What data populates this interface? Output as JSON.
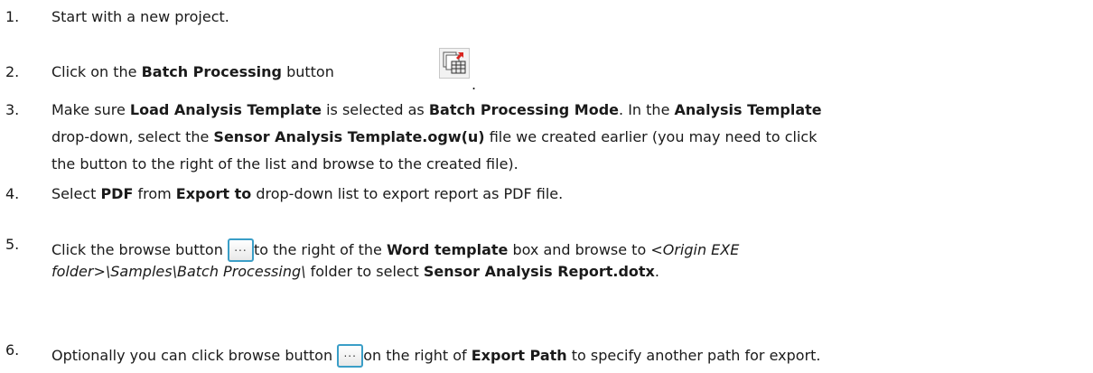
{
  "steps": [
    {
      "num": "1.",
      "text": "Start with a new project."
    },
    {
      "num": "2.",
      "pre": "Click on the ",
      "bold": "Batch Processing",
      "post": " button",
      "end": ".",
      "icon": "batch-processing-icon"
    },
    {
      "num": "3.",
      "l1": [
        "Make sure ",
        "Load Analysis Template",
        " is selected as ",
        "Batch Processing Mode",
        ". In the ",
        "Analysis Template"
      ],
      "l2": [
        "drop-down, select the ",
        "Sensor Analysis Template.ogw(u)",
        " file we created earlier (you may need to click"
      ],
      "l3": "the button to the right of the list and browse to the created file)."
    },
    {
      "num": "4.",
      "parts": [
        "Select ",
        "PDF",
        " from ",
        "Export to",
        " drop-down list to export report as PDF file."
      ]
    },
    {
      "num": "5.",
      "l1": [
        "Click the browse button ",
        "to the right of the ",
        "Word template",
        " box and browse to ",
        "<Origin EXE"
      ],
      "l2": [
        "folder>\\Samples\\Batch Processing\\",
        " folder to select ",
        "Sensor Analysis Report.dotx",
        "."
      ],
      "icon_glyph": "..."
    },
    {
      "num": "6.",
      "parts": [
        "Optionally you can click browse button ",
        "on the right of ",
        "Export Path",
        " to specify another path for export."
      ],
      "icon_glyph": "..."
    }
  ]
}
